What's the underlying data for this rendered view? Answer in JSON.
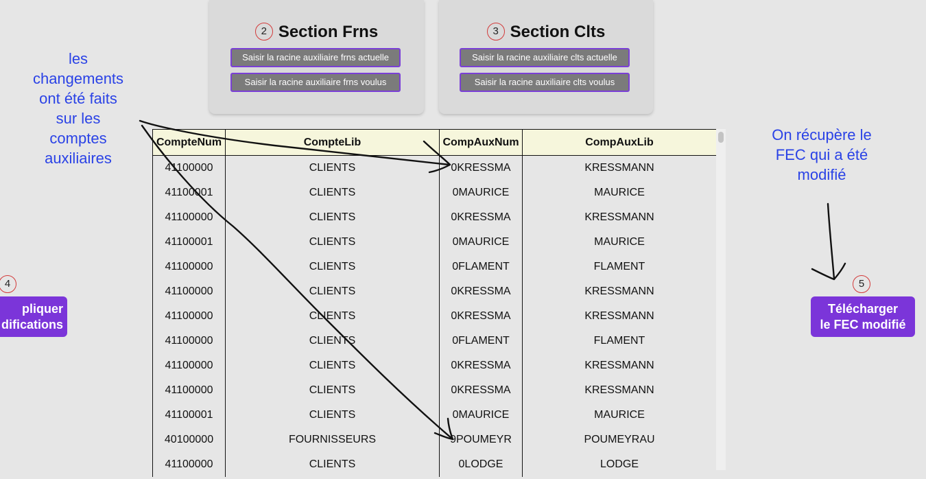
{
  "sections": {
    "frns": {
      "number": "2",
      "title": "Section Frns",
      "btn_current": "Saisir la racine auxiliaire frns actuelle",
      "btn_wanted": "Saisir la racine auxiliaire frns voulus"
    },
    "clts": {
      "number": "3",
      "title": "Section Clts",
      "btn_current": "Saisir la racine auxiliaire clts actuelle",
      "btn_wanted": "Saisir la racine auxiliaire clts voulus"
    }
  },
  "table": {
    "headers": [
      "CompteNum",
      "CompteLib",
      "CompAuxNum",
      "CompAuxLib"
    ],
    "rows": [
      [
        "41100000",
        "CLIENTS",
        "0KRESSMA",
        "KRESSMANN"
      ],
      [
        "41100001",
        "CLIENTS",
        "0MAURICE",
        "MAURICE"
      ],
      [
        "41100000",
        "CLIENTS",
        "0KRESSMA",
        "KRESSMANN"
      ],
      [
        "41100001",
        "CLIENTS",
        "0MAURICE",
        "MAURICE"
      ],
      [
        "41100000",
        "CLIENTS",
        "0FLAMENT",
        "FLAMENT"
      ],
      [
        "41100000",
        "CLIENTS",
        "0KRESSMA",
        "KRESSMANN"
      ],
      [
        "41100000",
        "CLIENTS",
        "0KRESSMA",
        "KRESSMANN"
      ],
      [
        "41100000",
        "CLIENTS",
        "0FLAMENT",
        "FLAMENT"
      ],
      [
        "41100000",
        "CLIENTS",
        "0KRESSMA",
        "KRESSMANN"
      ],
      [
        "41100000",
        "CLIENTS",
        "0KRESSMA",
        "KRESSMANN"
      ],
      [
        "41100001",
        "CLIENTS",
        "0MAURICE",
        "MAURICE"
      ],
      [
        "40100000",
        "FOURNISSEURS",
        "9POUMEYR",
        "POUMEYRAU"
      ],
      [
        "41100000",
        "CLIENTS",
        "0LODGE",
        "LODGE"
      ]
    ]
  },
  "annotations": {
    "left_lines": [
      "les",
      "changements",
      "ont été faits",
      "sur les",
      "comptes",
      "auxiliaires"
    ],
    "right_lines": [
      "On récupère le",
      "FEC qui a été",
      "modifié"
    ]
  },
  "apply_button": {
    "number": "4",
    "line1": "pliquer",
    "line2": "difications"
  },
  "download_button": {
    "number": "5",
    "line1": "Télécharger",
    "line2": "le FEC modifié"
  },
  "colors": {
    "accent_purple": "#7b35d9",
    "annotation_blue": "#2a42e6",
    "header_bg": "#f6f6dc",
    "circle_red": "#d23a3a"
  }
}
